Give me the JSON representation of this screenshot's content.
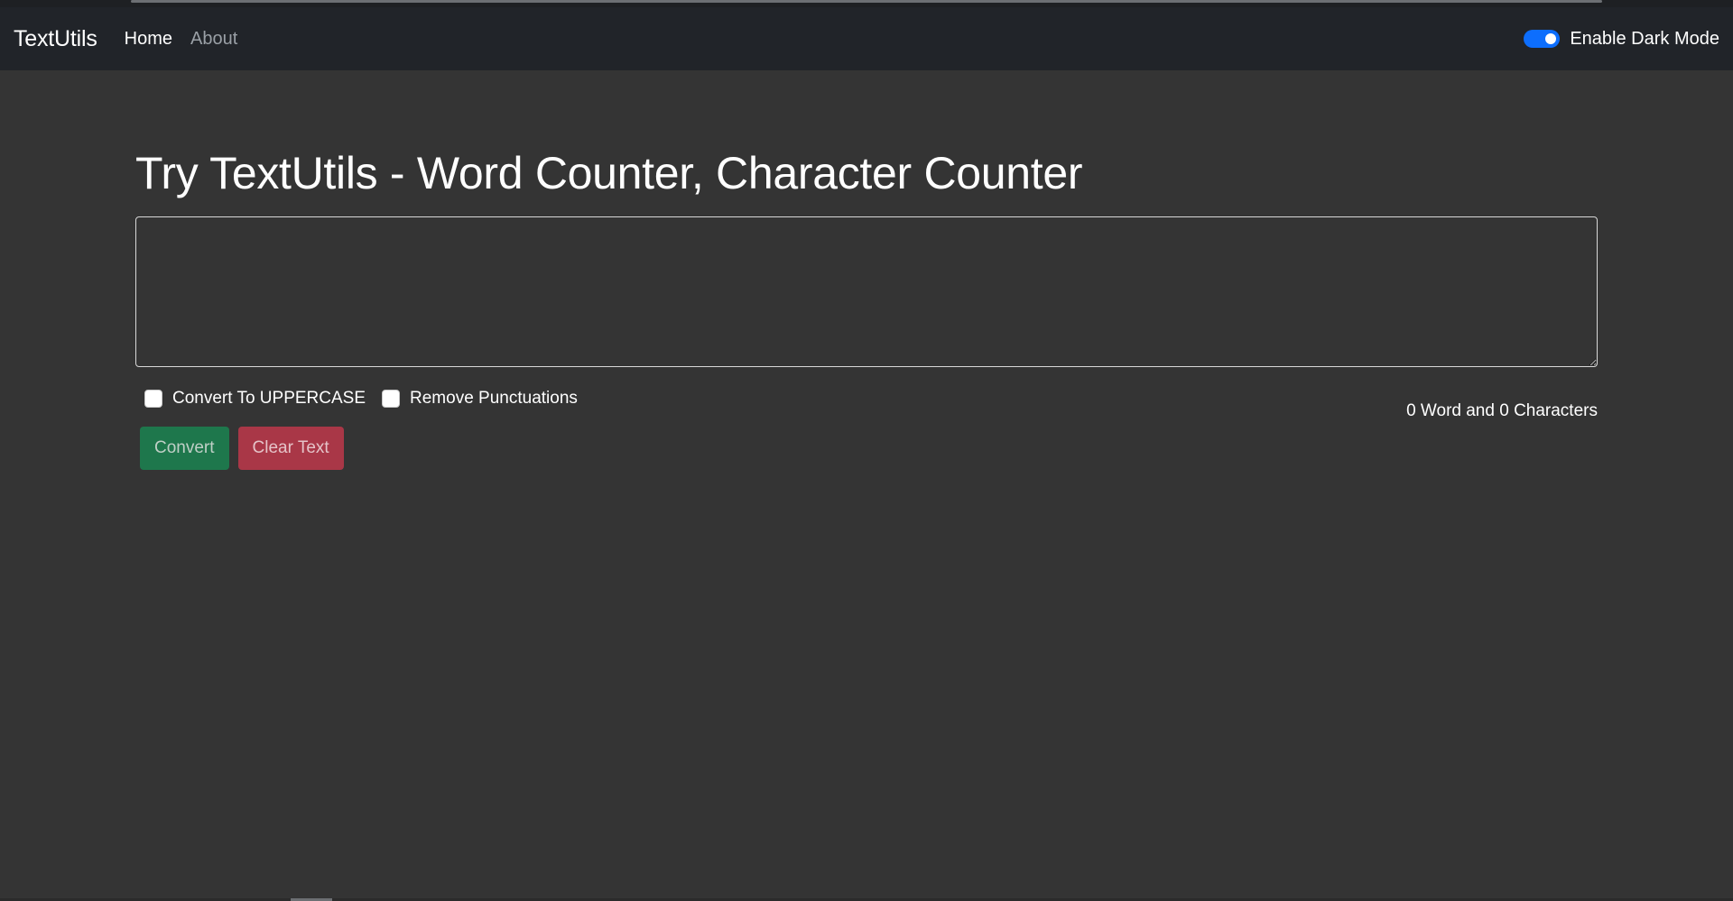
{
  "navbar": {
    "brand": "TextUtils",
    "links": [
      {
        "label": "Home",
        "active": true
      },
      {
        "label": "About",
        "active": false
      }
    ],
    "dark_mode_label": "Enable Dark Mode",
    "dark_mode_enabled": true
  },
  "main": {
    "title": "Try TextUtils - Word Counter, Character Counter",
    "textarea_value": "",
    "options": [
      {
        "label": "Convert To UPPERCASE",
        "checked": false
      },
      {
        "label": "Remove Punctuations",
        "checked": false
      }
    ],
    "buttons": {
      "convert_label": "Convert",
      "clear_label": "Clear Text"
    },
    "counter_text": "0 Word and 0 Characters"
  },
  "colors": {
    "background": "#343434",
    "navbar": "#212429",
    "switch_accent": "#0d6efd",
    "convert_button": "#1e774c",
    "clear_button": "#a93747"
  }
}
